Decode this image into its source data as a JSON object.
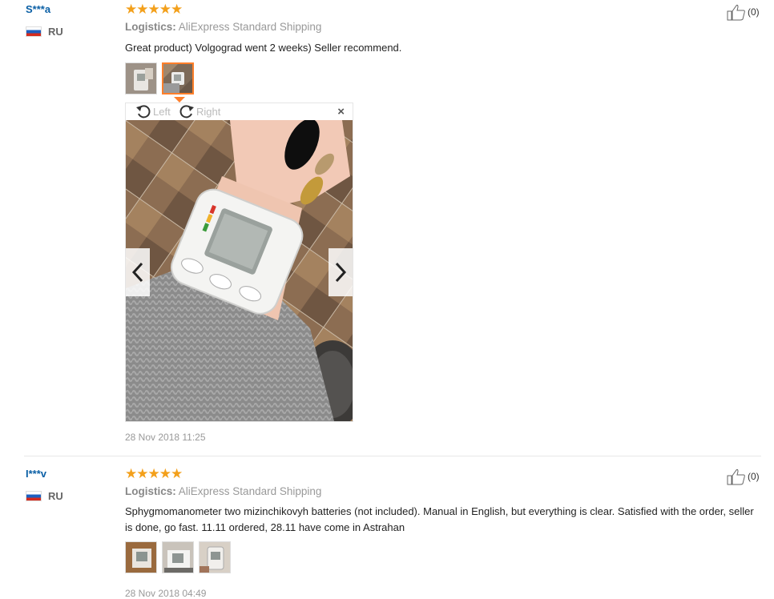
{
  "reviews": [
    {
      "user": "S***a",
      "country": "RU",
      "stars": "★★★★★",
      "logistics_label": "Logistics:",
      "logistics_value": "AliExpress Standard Shipping",
      "text": "Great product) Volgograd went 2 weeks) Seller recommend.",
      "date": "28 Nov 2018 11:25",
      "likes": "(0)"
    },
    {
      "user": "I***v",
      "country": "RU",
      "stars": "★★★★★",
      "logistics_label": "Logistics:",
      "logistics_value": "AliExpress Standard Shipping",
      "text": "Sphygmomanometer two mizinchikovyh batteries (not included). Manual in English, but everything is clear. Satisfied with the order, seller is done, go fast. 11.11 ordered, 28.11 have come in Astrahan",
      "date": "28 Nov 2018 04:49",
      "likes": "(0)"
    }
  ],
  "viewer": {
    "rotate_left": "Left",
    "rotate_right": "Right",
    "close": "×"
  },
  "colors": {
    "accent": "#ff7f2a",
    "star": "#f3a01b",
    "username": "#0a5fa5"
  }
}
